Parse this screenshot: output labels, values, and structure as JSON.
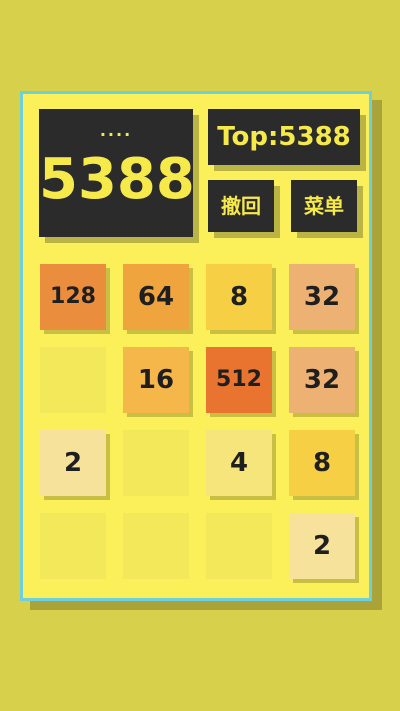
{
  "score": {
    "dots": "....",
    "value": "5388"
  },
  "top_score": "Top:5388",
  "buttons": {
    "undo_label": "撤回",
    "menu_label": "菜单"
  },
  "board": {
    "rows": [
      [
        "128",
        "64",
        "8",
        "32"
      ],
      [
        "",
        "16",
        "512",
        "32"
      ],
      [
        "2",
        "",
        "4",
        "8"
      ],
      [
        "",
        "",
        "",
        "2"
      ]
    ],
    "tile_colors": {
      "2": "#f6e29a",
      "4": "#f6e57a",
      "8": "#f7cf45",
      "16": "#f5b64a",
      "32": "#edb273",
      "64": "#f0a43e",
      "128": "#ea8d3c",
      "512": "#e8742f"
    }
  }
}
